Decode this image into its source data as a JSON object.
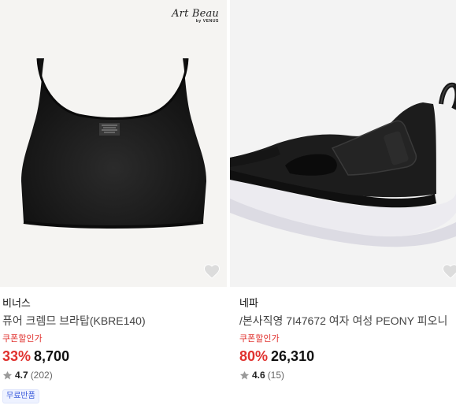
{
  "colors": {
    "discount": "#e0312e",
    "coupon": "#e0312e",
    "badge_text": "#3b5bdb",
    "badge_bg": "#eef2ff"
  },
  "products": [
    {
      "image_icon": "sports-bra-image",
      "brand_logo": "Art Beau",
      "brand_logo_sub": "by VENUS",
      "brand": "비너스",
      "title": "퓨어 크렘므 브라탑(KBRE140)",
      "coupon": "쿠폰할인가",
      "discount": "33%",
      "price": "8,700",
      "rating": "4.7",
      "reviews": "(202)",
      "badge": "무료반품"
    },
    {
      "image_icon": "black-sneaker-image",
      "brand": "네파",
      "title": "/본사직영 7I47672 여자 여성 PEONY 피오니",
      "coupon": "쿠폰할인가",
      "discount": "80%",
      "price": "26,310",
      "rating": "4.6",
      "reviews": "(15)"
    }
  ]
}
